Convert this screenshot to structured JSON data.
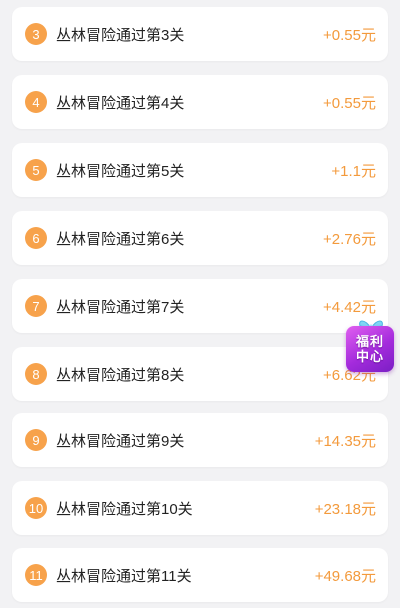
{
  "tasks": [
    {
      "num": "3",
      "title": "丛林冒险通过第3关",
      "reward": "+0.55元"
    },
    {
      "num": "4",
      "title": "丛林冒险通过第4关",
      "reward": "+0.55元"
    },
    {
      "num": "5",
      "title": "丛林冒险通过第5关",
      "reward": "+1.1元"
    },
    {
      "num": "6",
      "title": "丛林冒险通过第6关",
      "reward": "+2.76元"
    },
    {
      "num": "7",
      "title": "丛林冒险通过第7关",
      "reward": "+4.42元"
    },
    {
      "num": "8",
      "title": "丛林冒险通过第8关",
      "reward": "+6.62元"
    },
    {
      "num": "9",
      "title": "丛林冒险通过第9关",
      "reward": "+14.35元"
    },
    {
      "num": "10",
      "title": "丛林冒险通过第10关",
      "reward": "+23.18元"
    },
    {
      "num": "11",
      "title": "丛林冒险通过第11关",
      "reward": "+49.68元"
    }
  ],
  "welfare": {
    "line1": "福利",
    "line2": "中心",
    "icon": "gift-box-icon"
  },
  "colors": {
    "badge": "#f7a24b",
    "reward": "#f39a3c",
    "welfare": "#a42bdc"
  }
}
